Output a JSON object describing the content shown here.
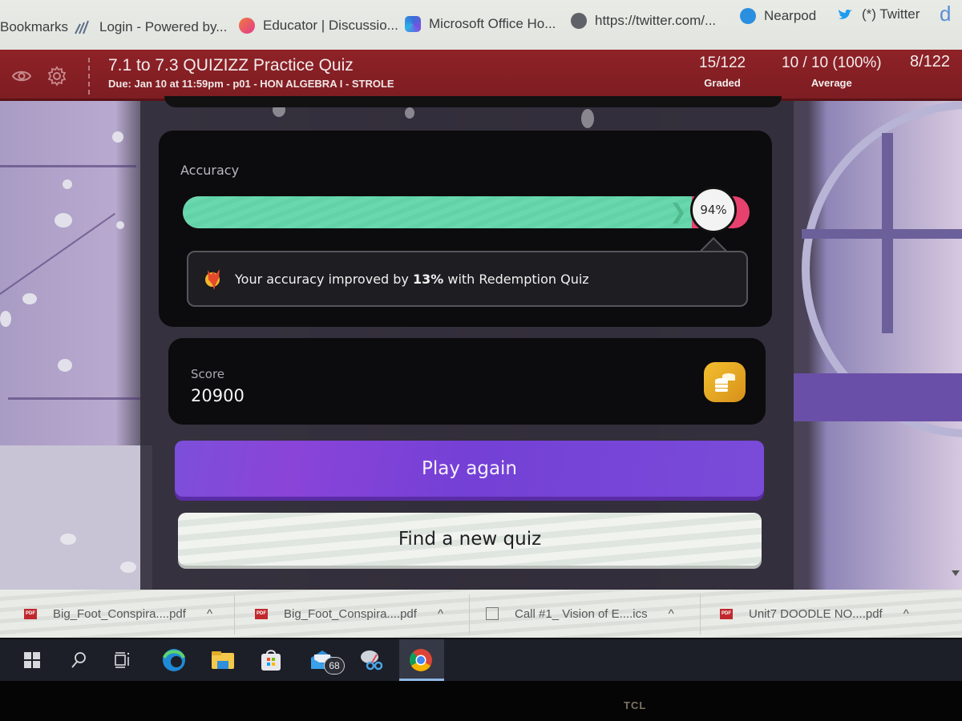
{
  "bookmarks_bar": {
    "items": [
      {
        "label": "Bookmarks",
        "icon": "bookmarks-folder-icon"
      },
      {
        "label": "Login - Powered by...",
        "icon": "sky-logo-icon"
      },
      {
        "label": "Educator | Discussio...",
        "icon": "educator-logo-icon"
      },
      {
        "label": "Microsoft Office Ho...",
        "icon": "microsoft-office-icon"
      },
      {
        "label": "https://twitter.com/...",
        "icon": "globe-icon"
      },
      {
        "label": "Nearpod",
        "icon": "nearpod-icon"
      },
      {
        "label": "(*) Twitter",
        "icon": "twitter-bird-icon"
      }
    ],
    "overflow_icon": "d-logo-icon"
  },
  "lms_header": {
    "title": "7.1 to 7.3 QUIZIZZ Practice Quiz",
    "due": "Due: Jan 10 at 11:59pm - p01 - HON ALGEBRA I - STROLE",
    "icons": [
      "eye-icon",
      "gear-icon"
    ],
    "stats": [
      {
        "value": "15/122",
        "label": "Graded"
      },
      {
        "value": "10 / 10 (100%)",
        "label": "Average"
      },
      {
        "value": "8/122",
        "label": ""
      }
    ],
    "color": "#8e2227"
  },
  "results": {
    "accuracy": {
      "label": "Accuracy",
      "percent": 94,
      "percent_label": "94%",
      "correct_color": "#62d3a8",
      "incorrect_color": "#e7416d",
      "message_prefix": "Your accuracy improved by ",
      "message_bold": "13%",
      "message_suffix": " with Redemption Quiz",
      "message_icon": "redemption-fox-icon"
    },
    "score": {
      "label": "Score",
      "value": "20900",
      "icon": "coins-icon"
    },
    "buttons": {
      "play_again": "Play again",
      "find_new_quiz": "Find a new quiz"
    },
    "accent_color": "#7c4fd9"
  },
  "downloads_bar": {
    "items": [
      {
        "name": "Big_Foot_Conspira....pdf",
        "type": "pdf"
      },
      {
        "name": "Big_Foot_Conspira....pdf",
        "type": "pdf"
      },
      {
        "name": "Call #1_ Vision of E....ics",
        "type": "ics"
      },
      {
        "name": "Unit7 DOODLE NO....pdf",
        "type": "pdf"
      }
    ],
    "caret": "^"
  },
  "taskbar": {
    "items": [
      {
        "name": "start",
        "icon": "windows-start-icon"
      },
      {
        "name": "search",
        "icon": "search-icon"
      },
      {
        "name": "task-view",
        "icon": "task-view-icon"
      },
      {
        "name": "edge",
        "icon": "edge-browser-icon"
      },
      {
        "name": "file-explorer",
        "icon": "folder-icon"
      },
      {
        "name": "store",
        "icon": "store-bag-icon"
      },
      {
        "name": "mail",
        "icon": "mail-icon"
      },
      {
        "name": "snipping-tool",
        "icon": "snipping-tool-icon"
      },
      {
        "name": "chrome",
        "icon": "chrome-icon",
        "active": true
      }
    ],
    "mail_badge": "68"
  },
  "monitor": {
    "brand": "TCL"
  }
}
